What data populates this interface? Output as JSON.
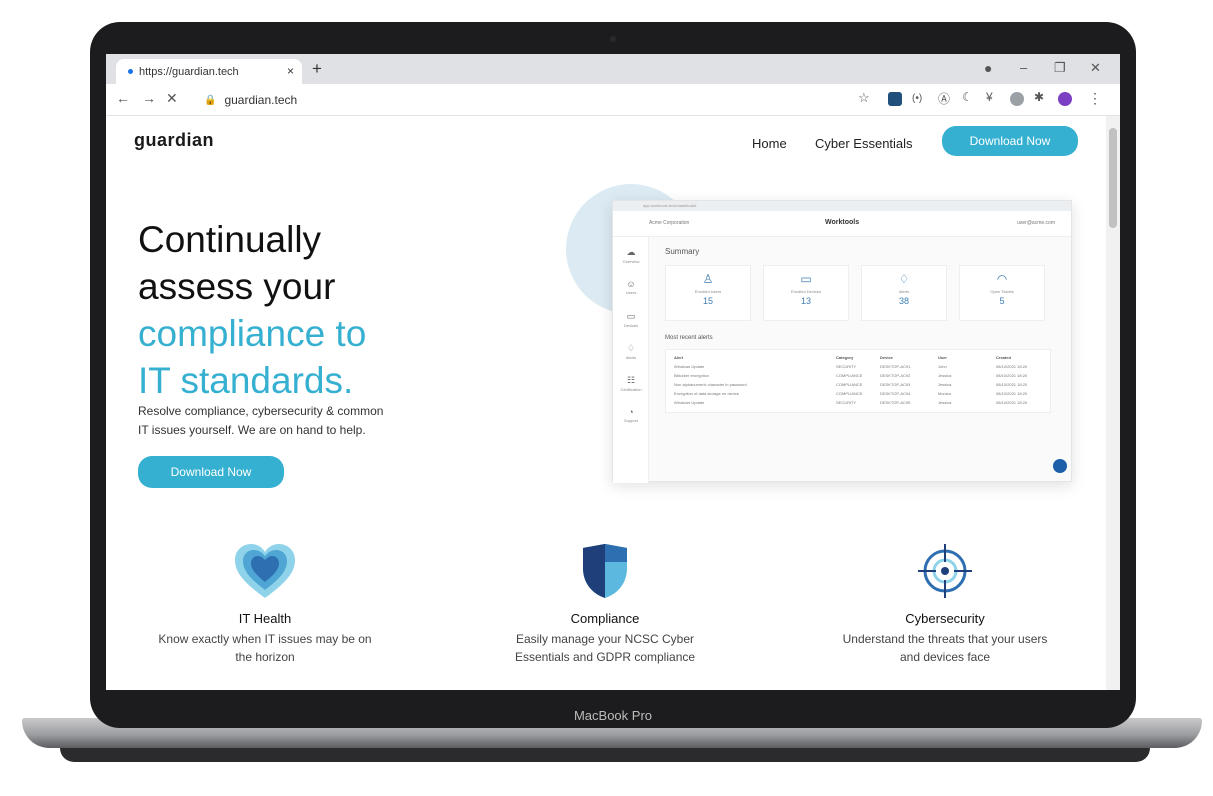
{
  "device": {
    "label": "MacBook Pro"
  },
  "browser": {
    "tab_title": "https://guardian.tech",
    "tab_close": "×",
    "new_tab": "+",
    "address": "guardian.tech",
    "window_controls": {
      "minimize": "–",
      "restore": "❐",
      "close": "✕"
    }
  },
  "site": {
    "logo": "guardian",
    "nav": {
      "home": "Home",
      "cyber_essentials": "Cyber Essentials",
      "download": "Download Now"
    },
    "hero": {
      "line1": "Continually",
      "line2": "assess your",
      "line3": "compliance to",
      "line4": "IT standards.",
      "subtitle_line1": "Resolve compliance, cybersecurity & common",
      "subtitle_line2": "IT issues yourself. We are on hand to help.",
      "cta": "Download Now"
    },
    "mockup": {
      "url": "app.worktools.tech/dashboard",
      "org": "Acme Corporation",
      "brand": "Worktools",
      "user": "user@acme.com",
      "summary_title": "Summary",
      "cards": [
        {
          "label": "Enrolled Users",
          "value": "15"
        },
        {
          "label": "Enrolled Devices",
          "value": "13"
        },
        {
          "label": "Alerts",
          "value": "38"
        },
        {
          "label": "Open Tickets",
          "value": "5"
        }
      ],
      "alerts_title": "Most recent alerts",
      "alert_headers": [
        "Alert",
        "Category",
        "Device",
        "User",
        "Created"
      ],
      "alert_rows": [
        [
          "Windows Update",
          "SECURITY",
          "DESKTOP-AC91",
          "John",
          "08/10/2021 18:20"
        ],
        [
          "Bitlocker encryption",
          "COMPLIANCE",
          "DESKTOP-AC92",
          "Jessica",
          "08/10/2021 18:20"
        ],
        [
          "Non alphanumeric character in password",
          "COMPLIANCE",
          "DESKTOP-AC93",
          "Jessica",
          "08/10/2021 18:20"
        ],
        [
          "Encryption of data storage on device",
          "COMPLIANCE",
          "DESKTOP-AC94",
          "Monica",
          "08/10/2021 18:20"
        ],
        [
          "Windows Update",
          "SECURITY",
          "DESKTOP-AC95",
          "Jessica",
          "08/10/2021 18:20"
        ]
      ],
      "sidebar": [
        "Overview",
        "Users",
        "Devices",
        "Alerts",
        "Certification",
        "Support"
      ]
    },
    "features": [
      {
        "title": "IT Health",
        "desc_line1": "Know exactly when IT issues may be on",
        "desc_line2": "the horizon"
      },
      {
        "title": "Compliance",
        "desc_line1": "Easily manage your NCSC Cyber",
        "desc_line2": "Essentials and GDPR compliance"
      },
      {
        "title": "Cybersecurity",
        "desc_line1": "Understand the threats that your users",
        "desc_line2": "and devices face"
      }
    ]
  },
  "colors": {
    "accent": "#36b0d1",
    "heart_outer": "#8fd3ea",
    "heart_inner": "#2d6fb0",
    "shield_dark": "#1f3f7a",
    "shield_light": "#5cb8df"
  },
  "icons": [
    "heart-icon",
    "shield-icon",
    "target-icon"
  ]
}
